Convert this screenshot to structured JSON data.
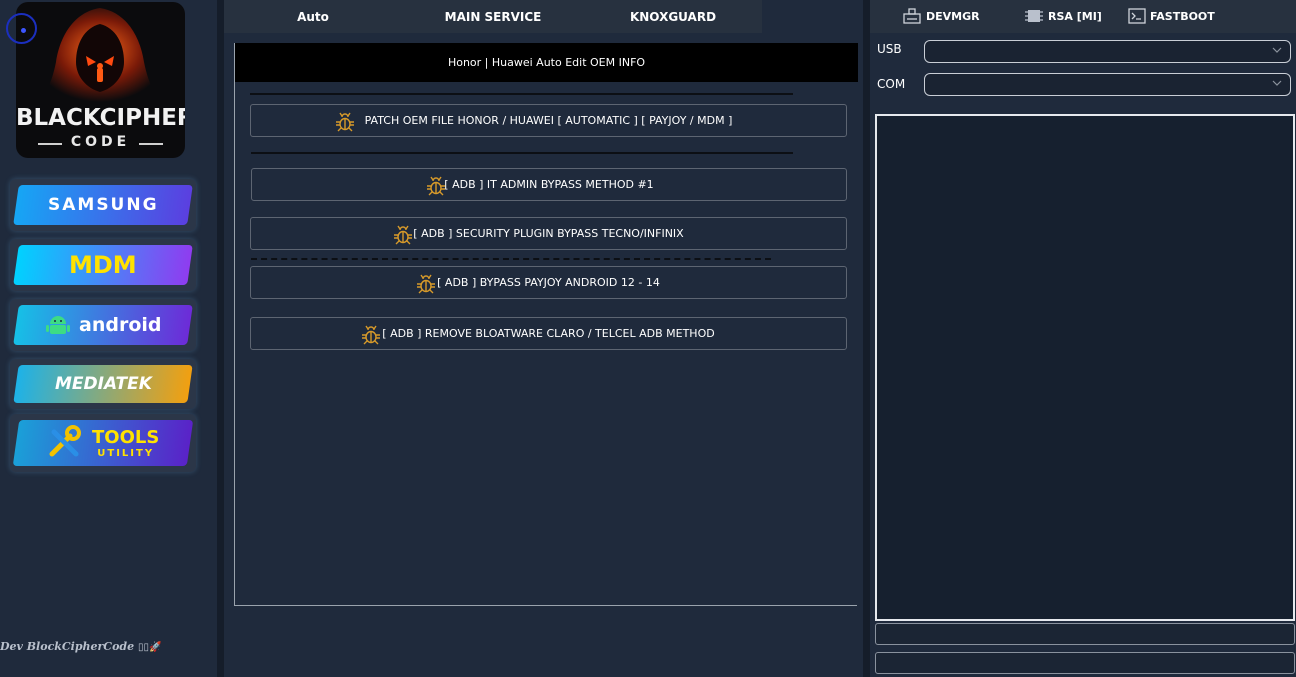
{
  "logo": {
    "line1": "BLACKCIPHER",
    "line2": "CODE"
  },
  "brands": [
    {
      "label": "SAMSUNG",
      "gradient": [
        "#16a6f5",
        "#5b3fe0"
      ],
      "text_color": "#ffffff"
    },
    {
      "label": "MDM",
      "gradient": [
        "#00d2ff",
        "#8f3cf0"
      ],
      "text_color": "#ffe200"
    },
    {
      "label": "android",
      "gradient": [
        "#16c0e6",
        "#6d2bd8"
      ],
      "text_color": "#ffffff"
    },
    {
      "label": "MEDIATEK",
      "gradient": [
        "#1db2e8",
        "#f2a010"
      ],
      "text_color": "#ffffff"
    },
    {
      "label_top": "TOOLS",
      "label_bottom": "UTILITY",
      "gradient": [
        "#1aa0d8",
        "#5a22c8"
      ],
      "text_color": "#ffe200"
    }
  ],
  "dev_credit": "Dev BlockCipherCode",
  "tabs": [
    "Auto",
    "MAIN SERVICE",
    "KNOXGUARD"
  ],
  "panel": {
    "title": "Honor | Huawei Auto Edit OEM INFO",
    "actions": [
      "PATCH OEM FILE HONOR / HUAWEI [ AUTOMATIC ]  [ PAYJOY / MDM ]",
      "[ ADB ] IT ADMIN BYPASS METHOD #1",
      "[ ADB ] SECURITY PLUGIN BYPASS TECNO/INFINIX",
      "[ ADB ] BYPASS PAYJOY ANDROID 12 - 14",
      "[ ADB ] REMOVE BLOATWARE CLARO / TELCEL  ADB METHOD"
    ]
  },
  "right": {
    "tools": [
      "DEVMGR",
      "RSA [MI]",
      "FASTBOOT"
    ],
    "usb_label": "USB",
    "usb_value": "",
    "com_label": "COM",
    "com_value": ""
  },
  "colors": {
    "accent_icon": "#d79a2a",
    "background": "#1f2a3c"
  }
}
